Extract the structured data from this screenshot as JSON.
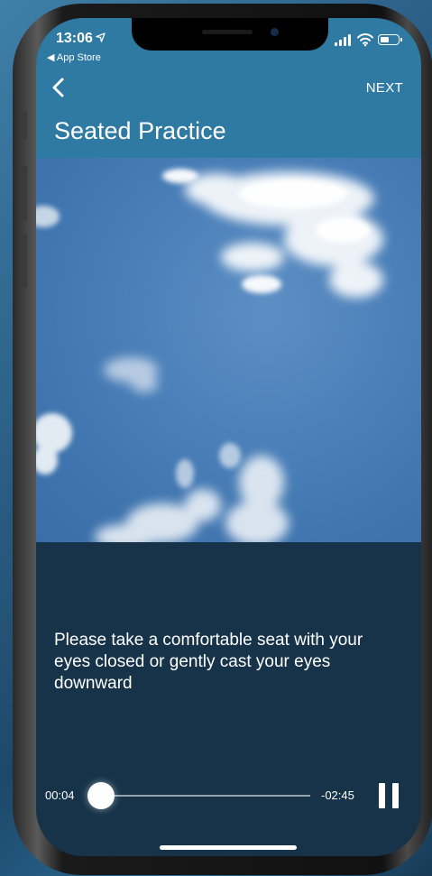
{
  "status_bar": {
    "time": "13:06",
    "back_app": "◀ App Store",
    "battery_level": 0.55
  },
  "nav": {
    "next_label": "NEXT"
  },
  "page": {
    "title": "Seated Practice"
  },
  "content": {
    "prompt": "Please take a comfortable seat with your eyes closed or gently cast your eyes downward"
  },
  "player": {
    "elapsed": "00:04",
    "remaining": "-02:45",
    "progress": 0.025
  },
  "colors": {
    "header": "#2f7aa3",
    "body": "#163349",
    "sky": "#4b80b9"
  },
  "icons": {
    "back": "chevron-left-icon",
    "pause": "pause-icon",
    "location": "location-arrow-icon",
    "signal": "cellular-signal-icon",
    "wifi": "wifi-icon",
    "battery": "battery-icon"
  }
}
